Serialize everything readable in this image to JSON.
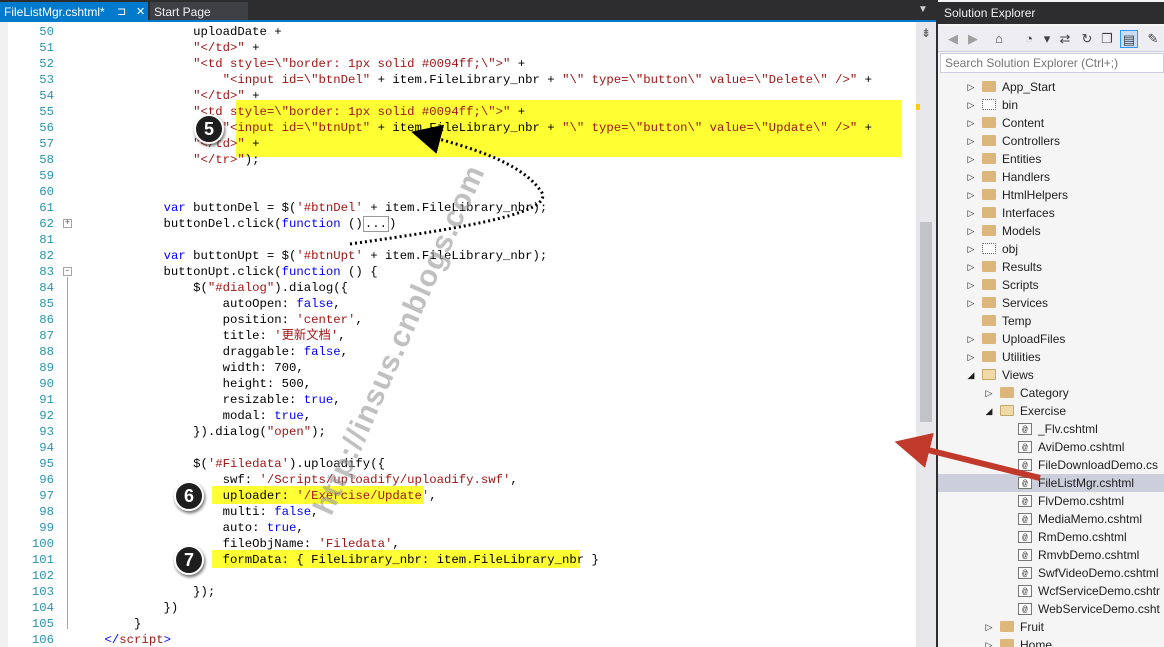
{
  "tabs": {
    "active": "FileListMgr.cshtml*",
    "active_pin": "⊐",
    "active_close": "✕",
    "inactive": "Start Page",
    "dropdown": "▼"
  },
  "editor": {
    "lines": [
      {
        "n": "50",
        "segs": [
          {
            "t": "                uploadDate +",
            "c": ""
          }
        ]
      },
      {
        "n": "51",
        "segs": [
          {
            "t": "                ",
            "c": ""
          },
          {
            "t": "\"</td>\"",
            "c": "s"
          },
          {
            "t": " +",
            "c": ""
          }
        ]
      },
      {
        "n": "52",
        "segs": [
          {
            "t": "                ",
            "c": ""
          },
          {
            "t": "\"<td style=\\\"border: 1px solid #0094ff;\\\">\"",
            "c": "s"
          },
          {
            "t": " +",
            "c": ""
          }
        ]
      },
      {
        "n": "53",
        "segs": [
          {
            "t": "                    ",
            "c": ""
          },
          {
            "t": "\"<input id=\\\"btnDel\"",
            "c": "s"
          },
          {
            "t": " + item.FileLibrary_nbr + ",
            "c": ""
          },
          {
            "t": "\"\\\" type=\\\"button\\\" value=\\\"Delete\\\" />\"",
            "c": "s"
          },
          {
            "t": " +",
            "c": ""
          }
        ]
      },
      {
        "n": "54",
        "segs": [
          {
            "t": "                ",
            "c": ""
          },
          {
            "t": "\"</td>\"",
            "c": "s"
          },
          {
            "t": " +",
            "c": ""
          }
        ]
      },
      {
        "n": "55",
        "segs": [
          {
            "t": "                ",
            "c": ""
          },
          {
            "t": "\"<td style=\\\"border: 1px solid #0094ff;\\\">\"",
            "c": "s"
          },
          {
            "t": " +",
            "c": ""
          }
        ]
      },
      {
        "n": "56",
        "segs": [
          {
            "t": "                    ",
            "c": ""
          },
          {
            "t": "\"<input id=\\\"btnUpt\"",
            "c": "s"
          },
          {
            "t": " + item.FileLibrary_nbr + ",
            "c": ""
          },
          {
            "t": "\"\\\" type=\\\"button\\\" value=\\\"Update\\\" />\"",
            "c": "s"
          },
          {
            "t": " +",
            "c": ""
          }
        ]
      },
      {
        "n": "57",
        "segs": [
          {
            "t": "                ",
            "c": ""
          },
          {
            "t": "\"</td>\"",
            "c": "s"
          },
          {
            "t": " +",
            "c": ""
          }
        ]
      },
      {
        "n": "58",
        "segs": [
          {
            "t": "                ",
            "c": ""
          },
          {
            "t": "\"</tr>\"",
            "c": "s"
          },
          {
            "t": ");",
            "c": ""
          }
        ]
      },
      {
        "n": "59",
        "segs": []
      },
      {
        "n": "60",
        "segs": []
      },
      {
        "n": "61",
        "segs": [
          {
            "t": "            ",
            "c": ""
          },
          {
            "t": "var",
            "c": "k"
          },
          {
            "t": " buttonDel = $(",
            "c": ""
          },
          {
            "t": "'#btnDel'",
            "c": "s"
          },
          {
            "t": " + item.FileLibrary_nbr);",
            "c": ""
          }
        ]
      },
      {
        "n": "62",
        "fold": "+",
        "segs": [
          {
            "t": "            buttonDel.click(",
            "c": ""
          },
          {
            "t": "function",
            "c": "k"
          },
          {
            "t": " ()",
            "c": ""
          },
          {
            "t": "...",
            "c": "collapsed"
          },
          {
            "t": ")",
            "c": ""
          }
        ]
      },
      {
        "n": "81",
        "segs": []
      },
      {
        "n": "82",
        "segs": [
          {
            "t": "            ",
            "c": ""
          },
          {
            "t": "var",
            "c": "k"
          },
          {
            "t": " buttonUpt = $(",
            "c": ""
          },
          {
            "t": "'#btnUpt'",
            "c": "s"
          },
          {
            "t": " + item.FileLibrary_nbr);",
            "c": ""
          }
        ]
      },
      {
        "n": "83",
        "fold": "-",
        "segs": [
          {
            "t": "            buttonUpt.click(",
            "c": ""
          },
          {
            "t": "function",
            "c": "k"
          },
          {
            "t": " () {",
            "c": ""
          }
        ]
      },
      {
        "n": "84",
        "segs": [
          {
            "t": "                $(",
            "c": ""
          },
          {
            "t": "\"#dialog\"",
            "c": "s"
          },
          {
            "t": ").dialog({",
            "c": ""
          }
        ]
      },
      {
        "n": "85",
        "segs": [
          {
            "t": "                    autoOpen: ",
            "c": ""
          },
          {
            "t": "false",
            "c": "k"
          },
          {
            "t": ",",
            "c": ""
          }
        ]
      },
      {
        "n": "86",
        "segs": [
          {
            "t": "                    position: ",
            "c": ""
          },
          {
            "t": "'center'",
            "c": "s"
          },
          {
            "t": ",",
            "c": ""
          }
        ]
      },
      {
        "n": "87",
        "segs": [
          {
            "t": "                    title: ",
            "c": ""
          },
          {
            "t": "'更新文档'",
            "c": "s"
          },
          {
            "t": ",",
            "c": ""
          }
        ]
      },
      {
        "n": "88",
        "segs": [
          {
            "t": "                    draggable: ",
            "c": ""
          },
          {
            "t": "false",
            "c": "k"
          },
          {
            "t": ",",
            "c": ""
          }
        ]
      },
      {
        "n": "89",
        "segs": [
          {
            "t": "                    width: 700,",
            "c": ""
          }
        ]
      },
      {
        "n": "90",
        "segs": [
          {
            "t": "                    height: 500,",
            "c": ""
          }
        ]
      },
      {
        "n": "91",
        "segs": [
          {
            "t": "                    resizable: ",
            "c": ""
          },
          {
            "t": "true",
            "c": "k"
          },
          {
            "t": ",",
            "c": ""
          }
        ]
      },
      {
        "n": "92",
        "segs": [
          {
            "t": "                    modal: ",
            "c": ""
          },
          {
            "t": "true",
            "c": "k"
          },
          {
            "t": ",",
            "c": ""
          }
        ]
      },
      {
        "n": "93",
        "segs": [
          {
            "t": "                }).dialog(",
            "c": ""
          },
          {
            "t": "\"open\"",
            "c": "s"
          },
          {
            "t": ");",
            "c": ""
          }
        ]
      },
      {
        "n": "94",
        "segs": []
      },
      {
        "n": "95",
        "segs": [
          {
            "t": "                $(",
            "c": ""
          },
          {
            "t": "'#Filedata'",
            "c": "s"
          },
          {
            "t": ").uploadify({",
            "c": ""
          }
        ]
      },
      {
        "n": "96",
        "segs": [
          {
            "t": "                    swf: ",
            "c": ""
          },
          {
            "t": "'/Scripts/uploadify/uploadify.swf'",
            "c": "s"
          },
          {
            "t": ",",
            "c": ""
          }
        ]
      },
      {
        "n": "97",
        "segs": [
          {
            "t": "                    uploader: ",
            "c": ""
          },
          {
            "t": "'/Exercise/Update'",
            "c": "s"
          },
          {
            "t": ",",
            "c": ""
          }
        ]
      },
      {
        "n": "98",
        "segs": [
          {
            "t": "                    multi: ",
            "c": ""
          },
          {
            "t": "false",
            "c": "k"
          },
          {
            "t": ",",
            "c": ""
          }
        ]
      },
      {
        "n": "99",
        "segs": [
          {
            "t": "                    auto: ",
            "c": ""
          },
          {
            "t": "true",
            "c": "k"
          },
          {
            "t": ",",
            "c": ""
          }
        ]
      },
      {
        "n": "100",
        "segs": [
          {
            "t": "                    fileObjName: ",
            "c": ""
          },
          {
            "t": "'Filedata'",
            "c": "s"
          },
          {
            "t": ",",
            "c": ""
          }
        ]
      },
      {
        "n": "101",
        "segs": [
          {
            "t": "                    formData: { FileLibrary_nbr: item.FileLibrary_nbr }",
            "c": ""
          }
        ]
      },
      {
        "n": "102",
        "segs": []
      },
      {
        "n": "103",
        "segs": [
          {
            "t": "                });",
            "c": ""
          }
        ]
      },
      {
        "n": "104",
        "segs": [
          {
            "t": "            })",
            "c": ""
          }
        ]
      },
      {
        "n": "105",
        "segs": [
          {
            "t": "        }",
            "c": ""
          }
        ]
      },
      {
        "n": "106",
        "segs": [
          {
            "t": "    ",
            "c": ""
          },
          {
            "t": "</",
            "c": "k"
          },
          {
            "t": "script",
            "c": "s"
          },
          {
            "t": ">",
            "c": "k"
          }
        ]
      }
    ],
    "badges": [
      "5",
      "6",
      "7"
    ],
    "watermark": "http://insus.cnblogs.com",
    "split_icon": "⇟"
  },
  "solution_explorer": {
    "title": "Solution Explorer",
    "toolbar": [
      {
        "name": "back-icon",
        "glyph": "◀",
        "dim": true
      },
      {
        "name": "forward-icon",
        "glyph": "▶",
        "dim": true
      },
      {
        "name": "home-icon",
        "glyph": "⌂",
        "dim": false
      },
      {
        "name": "history-icon",
        "glyph": "◔",
        "dim": false
      },
      {
        "name": "history-dropdown-icon",
        "glyph": "▾",
        "dim": false
      },
      {
        "name": "sync-icon",
        "glyph": "⇄",
        "dim": false
      },
      {
        "name": "refresh-icon",
        "glyph": "↻",
        "dim": false
      },
      {
        "name": "collapse-all-icon",
        "glyph": "❐",
        "dim": false
      },
      {
        "name": "show-all-files-icon",
        "glyph": "▤",
        "dim": false,
        "on": true
      },
      {
        "name": "properties-icon",
        "glyph": "✎",
        "dim": false
      }
    ],
    "search_placeholder": "Search Solution Explorer (Ctrl+;)",
    "tree": [
      {
        "label": "App_Start",
        "level": 0,
        "exp": "▷",
        "icon": "folder"
      },
      {
        "label": "bin",
        "level": 0,
        "exp": "▷",
        "icon": "ghost"
      },
      {
        "label": "Content",
        "level": 0,
        "exp": "▷",
        "icon": "folder"
      },
      {
        "label": "Controllers",
        "level": 0,
        "exp": "▷",
        "icon": "folder"
      },
      {
        "label": "Entities",
        "level": 0,
        "exp": "▷",
        "icon": "folder"
      },
      {
        "label": "Handlers",
        "level": 0,
        "exp": "▷",
        "icon": "folder"
      },
      {
        "label": "HtmlHelpers",
        "level": 0,
        "exp": "▷",
        "icon": "folder"
      },
      {
        "label": "Interfaces",
        "level": 0,
        "exp": "▷",
        "icon": "folder"
      },
      {
        "label": "Models",
        "level": 0,
        "exp": "▷",
        "icon": "folder"
      },
      {
        "label": "obj",
        "level": 0,
        "exp": "▷",
        "icon": "ghost"
      },
      {
        "label": "Results",
        "level": 0,
        "exp": "▷",
        "icon": "folder"
      },
      {
        "label": "Scripts",
        "level": 0,
        "exp": "▷",
        "icon": "folder"
      },
      {
        "label": "Services",
        "level": 0,
        "exp": "▷",
        "icon": "folder"
      },
      {
        "label": "Temp",
        "level": 0,
        "exp": "",
        "icon": "folder"
      },
      {
        "label": "UploadFiles",
        "level": 0,
        "exp": "▷",
        "icon": "folder"
      },
      {
        "label": "Utilities",
        "level": 0,
        "exp": "▷",
        "icon": "folder"
      },
      {
        "label": "Views",
        "level": 0,
        "exp": "◢",
        "icon": "open"
      },
      {
        "label": "Category",
        "level": 1,
        "exp": "▷",
        "icon": "folder"
      },
      {
        "label": "Exercise",
        "level": 1,
        "exp": "◢",
        "icon": "open"
      },
      {
        "label": "_Flv.cshtml",
        "level": 2,
        "exp": "",
        "icon": "file"
      },
      {
        "label": "AviDemo.cshtml",
        "level": 2,
        "exp": "",
        "icon": "file"
      },
      {
        "label": "FileDownloadDemo.cs",
        "level": 2,
        "exp": "",
        "icon": "file"
      },
      {
        "label": "FileListMgr.cshtml",
        "level": 2,
        "exp": "",
        "icon": "file",
        "sel": true
      },
      {
        "label": "FlvDemo.cshtml",
        "level": 2,
        "exp": "",
        "icon": "file"
      },
      {
        "label": "MediaMemo.cshtml",
        "level": 2,
        "exp": "",
        "icon": "file"
      },
      {
        "label": "RmDemo.cshtml",
        "level": 2,
        "exp": "",
        "icon": "file"
      },
      {
        "label": "RmvbDemo.cshtml",
        "level": 2,
        "exp": "",
        "icon": "file"
      },
      {
        "label": "SwfVideoDemo.cshtml",
        "level": 2,
        "exp": "",
        "icon": "file"
      },
      {
        "label": "WcfServiceDemo.cshtr",
        "level": 2,
        "exp": "",
        "icon": "file"
      },
      {
        "label": "WebServiceDemo.csht",
        "level": 2,
        "exp": "",
        "icon": "file"
      },
      {
        "label": "Fruit",
        "level": 1,
        "exp": "▷",
        "icon": "folder"
      },
      {
        "label": "Home",
        "level": 1,
        "exp": "▷",
        "icon": "folder"
      }
    ],
    "file_glyph": "@"
  },
  "colors": {
    "highlight": "#ffff33",
    "arrow_red": "#c0392b",
    "accent": "#007acc"
  }
}
